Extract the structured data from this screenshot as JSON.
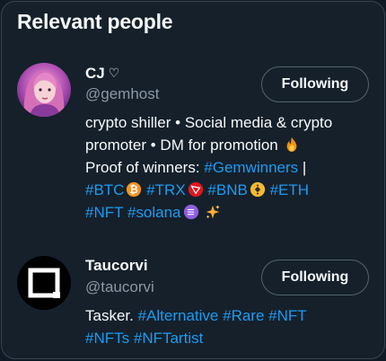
{
  "panel": {
    "title": "Relevant people"
  },
  "people": [
    {
      "name": "CJ",
      "name_suffix": "♡",
      "handle": "@gemhost",
      "follow_label": "Following",
      "bio": {
        "line1": "crypto shiller • Social media & crypto",
        "line2": "promoter • DM for promotion",
        "line3_text": "Proof of winners: ",
        "line3_tag": "#Gemwinners",
        "line3_end": " |",
        "tags_line4": [
          "#BTC",
          "#TRX",
          "#BNB",
          "#ETH"
        ],
        "tags_line5": [
          "#NFT",
          "#solana"
        ]
      },
      "emojis": [
        "fire-emoji",
        "bitcoin-emoji",
        "tron-emoji",
        "bnb-emoji",
        "solana-emoji",
        "sparkles-emoji"
      ]
    },
    {
      "name": "Taucorvi",
      "handle": "@taucorvi",
      "follow_label": "Following",
      "bio": {
        "line1_text": "Tasker. ",
        "tags_line1": [
          "#Alternative",
          "#Rare",
          "#NFT"
        ],
        "tags_line2": [
          "#NFTs",
          "#NFTartist"
        ]
      }
    }
  ],
  "colors": {
    "background": "#15202b",
    "text": "#f7f9f9",
    "secondary_text": "#8b98a5",
    "link": "#1d9bf0",
    "border": "#38444d"
  }
}
